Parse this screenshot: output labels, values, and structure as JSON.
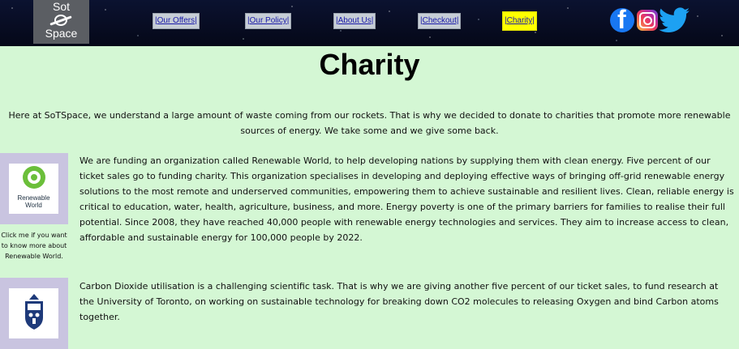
{
  "header": {
    "logo": {
      "line1": "Sot",
      "line2": "Space"
    },
    "nav": [
      {
        "label": "|Our Offers|",
        "active": false
      },
      {
        "label": "|Our Policy|",
        "active": false
      },
      {
        "label": "|About Us|",
        "active": false
      },
      {
        "label": "|Checkout|",
        "active": false
      },
      {
        "label": "|Charity|",
        "active": true
      }
    ],
    "social": [
      "facebook-icon",
      "instagram-icon",
      "twitter-icon"
    ]
  },
  "main": {
    "title": "Charity",
    "intro": "Here at SoTSpace, we understand a large amount of waste coming from our rockets. That is why we decided to donate to charities that promote more renewable sources of energy. We take some and we give some back.",
    "charities": [
      {
        "logo_text": "Renewable World",
        "caption": "Click me if you want to know more about Renewable World.",
        "text": "We are funding an organization called Renewable World, to help developing nations by supplying them with clean energy. Five percent of our ticket sales go to funding charity. This organization specialises in developing and deploying effective ways of bringing off-grid renewable energy solutions to the most remote and underserved communities, empowering them to achieve sustainable and resilient lives. Clean, reliable energy is critical to education, water, health, agriculture, business, and more. Energy poverty is one of the primary barriers for families to realise their full potential. Since 2008, they have reached 40,000 people with renewable energy technologies and services. They aim to increase access to clean, affordable and sustainable energy for 100,000 people by 2022."
      },
      {
        "text": "Carbon Dioxide utilisation is a challenging scientific task. That is why we are giving another five percent of our ticket sales, to fund research at the University of Toronto, on working on sustainable technology for breaking down CO2 molecules to releasing Oxygen and bind Carbon atoms together."
      }
    ]
  },
  "colors": {
    "page_background": "#d4f7d4",
    "active_nav": "#ffff00",
    "image_frame": "#c9c4e0"
  }
}
